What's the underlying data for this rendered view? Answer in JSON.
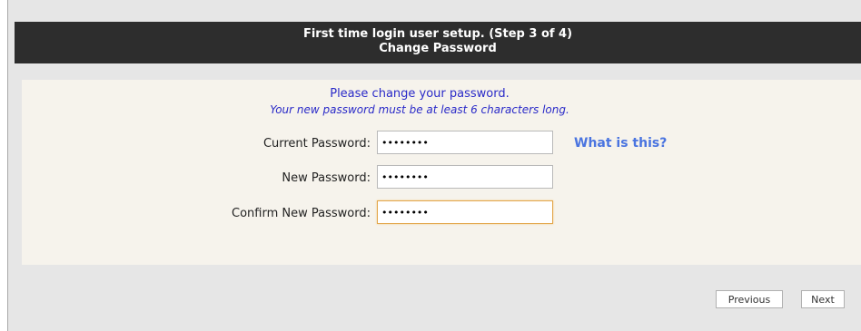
{
  "header": {
    "line1": "First time login user setup. (Step 3 of 4)",
    "line2": "Change Password"
  },
  "intro": {
    "message": "Please change your password.",
    "hint": "Your new password must be at least 6 characters long."
  },
  "form": {
    "current_password_label": "Current Password:",
    "current_password_value": "••••••••",
    "new_password_label": "New Password:",
    "new_password_value": "••••••••",
    "confirm_password_label": "Confirm New Password:",
    "confirm_password_value": "••••••••",
    "help_link": "What is this?"
  },
  "buttons": {
    "previous": "Previous",
    "next": "Next"
  },
  "colors": {
    "header_bg": "#2d2d2d",
    "panel_bg": "#f6f3ec",
    "intro_text": "#2a2ac8",
    "link": "#4a74e0",
    "focus_border": "#e3a64a"
  }
}
